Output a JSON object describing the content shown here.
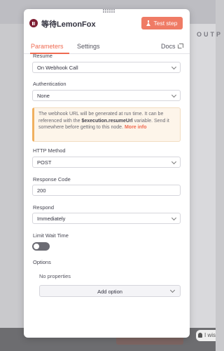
{
  "background": {
    "output_label": "OUTP",
    "hint_text": "I wis"
  },
  "node": {
    "title": "等待LemonFox",
    "icon": "pause-circle-icon",
    "test_step_label": "Test step"
  },
  "tabs": {
    "parameters": "Parameters",
    "settings": "Settings",
    "docs": "Docs"
  },
  "resume": {
    "label": "Resume",
    "value": "On Webhook Call"
  },
  "authentication": {
    "label": "Authentication",
    "value": "None"
  },
  "notice": {
    "text_before": "The webhook URL will be generated at run time. It can be referenced with the ",
    "variable": "$execution.resumeUrl",
    "text_after": " variable. Send it somewhere before getting to this node. ",
    "more_info": "More info"
  },
  "http_method": {
    "label": "HTTP Method",
    "value": "POST"
  },
  "response_code": {
    "label": "Response Code",
    "value": "200"
  },
  "respond": {
    "label": "Respond",
    "value": "Immediately"
  },
  "limit_wait_time": {
    "label": "Limit Wait Time",
    "enabled": false
  },
  "options": {
    "label": "Options",
    "empty_text": "No properties",
    "add_option_label": "Add option"
  },
  "colors": {
    "accent": "#ef6a51",
    "test_button": "#ef7b65",
    "node_icon": "#7d1e33",
    "notice_border": "#f0b060"
  }
}
